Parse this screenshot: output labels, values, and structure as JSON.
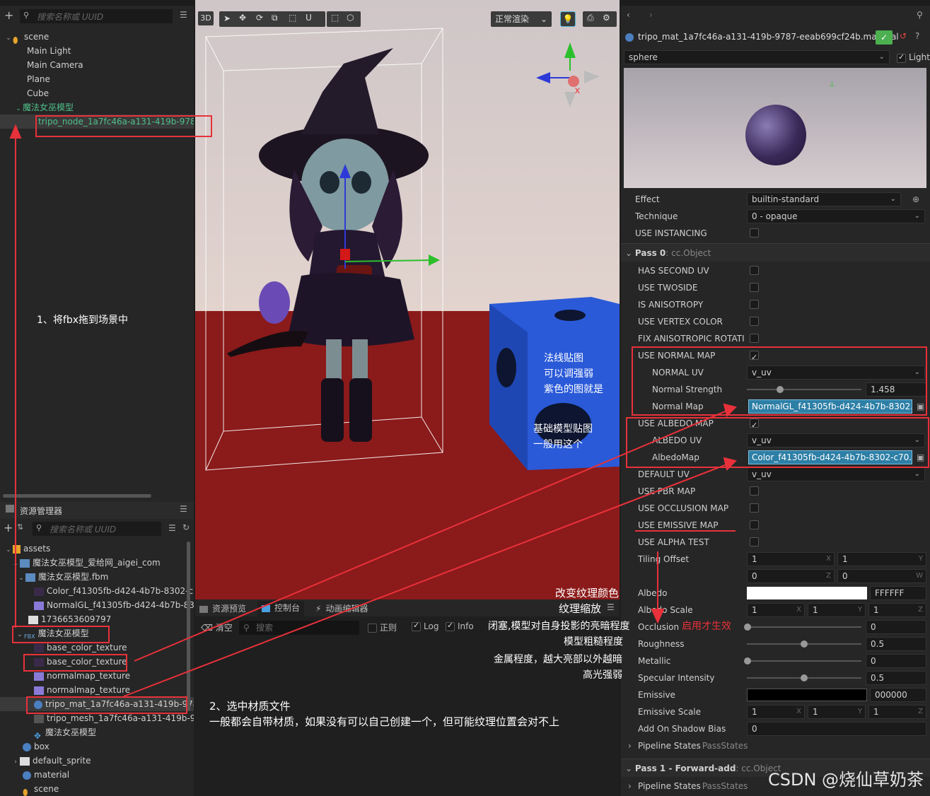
{
  "hierarchy": {
    "search_placeholder": "搜索名称或 UUID",
    "items": [
      {
        "label": "scene"
      },
      {
        "label": "Main Light"
      },
      {
        "label": "Main Camera"
      },
      {
        "label": "Plane"
      },
      {
        "label": "Cube"
      },
      {
        "label": "魔法女巫模型"
      },
      {
        "label": "tripo_node_1a7fc46a-a131-419b-9787-ee"
      }
    ]
  },
  "scene_toolbar": {
    "mode_3d": "3D",
    "render_mode": "正常渲染"
  },
  "assets": {
    "title": "资源管理器",
    "search_placeholder": "搜索名称或 UUID",
    "items": [
      {
        "label": "assets"
      },
      {
        "label": "魔法女巫模型_爱给网_aigei_com"
      },
      {
        "label": "魔法女巫模型.fbm"
      },
      {
        "label": "Color_f41305fb-d424-4b7b-8302-c7("
      },
      {
        "label": "NormalGL_f41305fb-d424-4b7b-830"
      },
      {
        "label": "1736653609797"
      },
      {
        "label": "魔法女巫模型"
      },
      {
        "label": "base_color_texture"
      },
      {
        "label": "base_color_texture"
      },
      {
        "label": "normalmap_texture"
      },
      {
        "label": "normalmap_texture"
      },
      {
        "label": "tripo_mat_1a7fc46a-a131-419b-978"
      },
      {
        "label": "tripo_mesh_1a7fc46a-a131-419b-97"
      },
      {
        "label": "魔法女巫模型"
      },
      {
        "label": "box"
      },
      {
        "label": "default_sprite"
      },
      {
        "label": "material"
      },
      {
        "label": "scene"
      }
    ]
  },
  "console": {
    "tabs": [
      {
        "label": "资源预览"
      },
      {
        "label": "控制台"
      },
      {
        "label": "动画编辑器"
      }
    ],
    "clear": "清空",
    "search": "搜索",
    "regex": "正则",
    "log": "Log",
    "info": "Info"
  },
  "inspector": {
    "file_name": "tripo_mat_1a7fc46a-a131-419b-9787-eeab699cf24b.material",
    "preview_mesh": "sphere",
    "light_label": "Light",
    "effect_label": "Effect",
    "effect_value": "builtin-standard",
    "technique_label": "Technique",
    "technique_value": "0 - opaque",
    "use_instancing": "USE INSTANCING",
    "pass0_title": "Pass 0",
    "pass0_type": ": cc.Object",
    "props": {
      "has_second_uv": "HAS SECOND UV",
      "use_twoside": "USE TWOSIDE",
      "is_anisotropy": "IS ANISOTROPY",
      "use_vertex_color": "USE VERTEX COLOR",
      "fix_anisotropic": "FIX ANISOTROPIC ROTATI",
      "use_normal_map": "USE NORMAL MAP",
      "normal_uv": "NORMAL UV",
      "normal_uv_value": "v_uv",
      "normal_strength": "Normal Strength",
      "normal_strength_value": "1.458",
      "normal_map": "Normal Map",
      "normal_map_value": "NormalGL_f41305fb-d424-4b7b-8302...",
      "use_albedo_map": "USE ALBEDO MAP",
      "albedo_uv": "ALBEDO UV",
      "albedo_uv_value": "v_uv",
      "albedo_map": "AlbedoMap",
      "albedo_map_value": "Color_f41305fb-d424-4b7b-8302-c70...",
      "default_uv": "DEFAULT UV",
      "default_uv_value": "v_uv",
      "use_pbr_map": "USE PBR MAP",
      "use_occlusion_map": "USE OCCLUSION MAP",
      "use_emissive_map": "USE EMISSIVE MAP",
      "use_alpha_test": "USE ALPHA TEST",
      "tiling_offset": "Tiling Offset",
      "tiling": [
        "1",
        "1",
        "0",
        "0"
      ],
      "albedo": "Albedo",
      "albedo_hex": "FFFFFF",
      "albedo_scale": "Albedo Scale",
      "albedo_scale_values": [
        "1",
        "1",
        "1"
      ],
      "occlusion": "Occlusion",
      "occlusion_value": "0",
      "roughness": "Roughness",
      "roughness_value": "0.5",
      "metallic": "Metallic",
      "metallic_value": "0",
      "specular": "Specular Intensity",
      "specular_value": "0.5",
      "emissive": "Emissive",
      "emissive_hex": "000000",
      "emissive_scale": "Emissive Scale",
      "emissive_scale_values": [
        "1",
        "1",
        "1"
      ],
      "shadow_bias": "Add On Shadow Bias",
      "shadow_bias_value": "0",
      "pipeline_states": "Pipeline States",
      "pass_states": ": PassStates"
    },
    "pass1_title": "Pass 1 - Forward-add",
    "pass1_type": ": cc.Object"
  },
  "annotations": {
    "step1": "1、将fbx拖到场景中",
    "normal_note": [
      "法线贴图",
      "可以调强弱",
      "紫色的图就是"
    ],
    "albedo_note": [
      "基础模型贴图",
      "一般用这个"
    ],
    "albedo_color_note": "改变纹理颜色",
    "albedo_scale_note": "纹理缩放",
    "occlusion_note": "闭塞,模型对自身投影的亮暗程度",
    "occlusion_red": "启用才生效",
    "roughness_note": "模型粗糙程度",
    "metallic_note": [
      "金属程度，越大亮部以外越暗",
      "高光强弱"
    ],
    "step2": "2、选中材质文件",
    "step2_sub": "一般都会自带材质，如果没有可以自己创建一个，但可能纹理位置会对不上",
    "watermark": "CSDN @烧仙草奶茶"
  }
}
